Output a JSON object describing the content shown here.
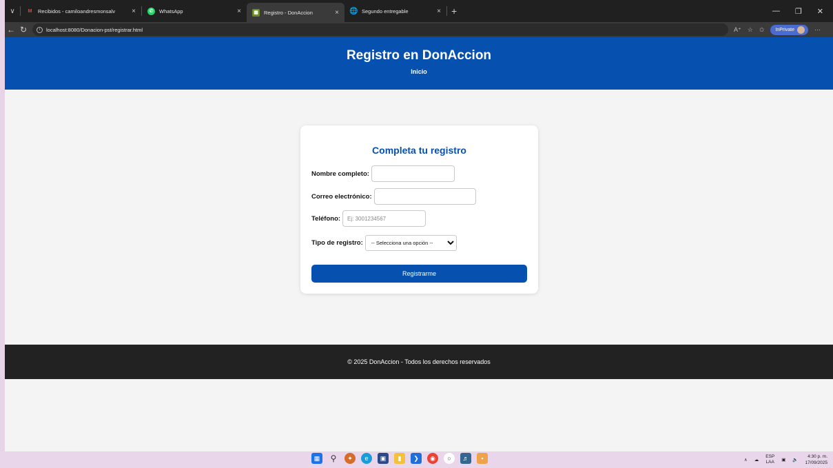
{
  "browser": {
    "tabs": [
      {
        "label": "Recibidos - camiloandresmonsalv",
        "favicon": "gmail-icon",
        "color": "#ea4335",
        "active": false
      },
      {
        "label": "WhatsApp",
        "favicon": "whatsapp-icon",
        "color": "#25d366",
        "active": false
      },
      {
        "label": "Registro - DonAccion",
        "favicon": "page-icon",
        "color": "#6b8e23",
        "active": true
      },
      {
        "label": "Segundo entregable",
        "favicon": "globe-icon",
        "color": "#bbbbbb",
        "active": false
      }
    ],
    "url": "localhost:8080/Donacion-pst/registrar.html",
    "inprivate_label": "InPrivate"
  },
  "header": {
    "title": "Registro en DonAccion",
    "nav_link": "Inicio"
  },
  "form": {
    "title": "Completa tu registro",
    "name_label": "Nombre completo:",
    "email_label": "Correo electrónico:",
    "phone_label": "Teléfono:",
    "phone_placeholder": "Ej: 3001234567",
    "type_label": "Tipo de registro:",
    "type_selected": "-- Selecciona una opción --",
    "submit_label": "Registrarme"
  },
  "footer": {
    "text": "© 2025 DonAccion - Todos los derechos reservados"
  },
  "taskbar": {
    "lang_top": "ESP",
    "lang_bottom": "LAA",
    "time": "4:30 p. m.",
    "date": "17/09/2025"
  },
  "colors": {
    "brand": "#0650b0",
    "footer": "#222222"
  }
}
